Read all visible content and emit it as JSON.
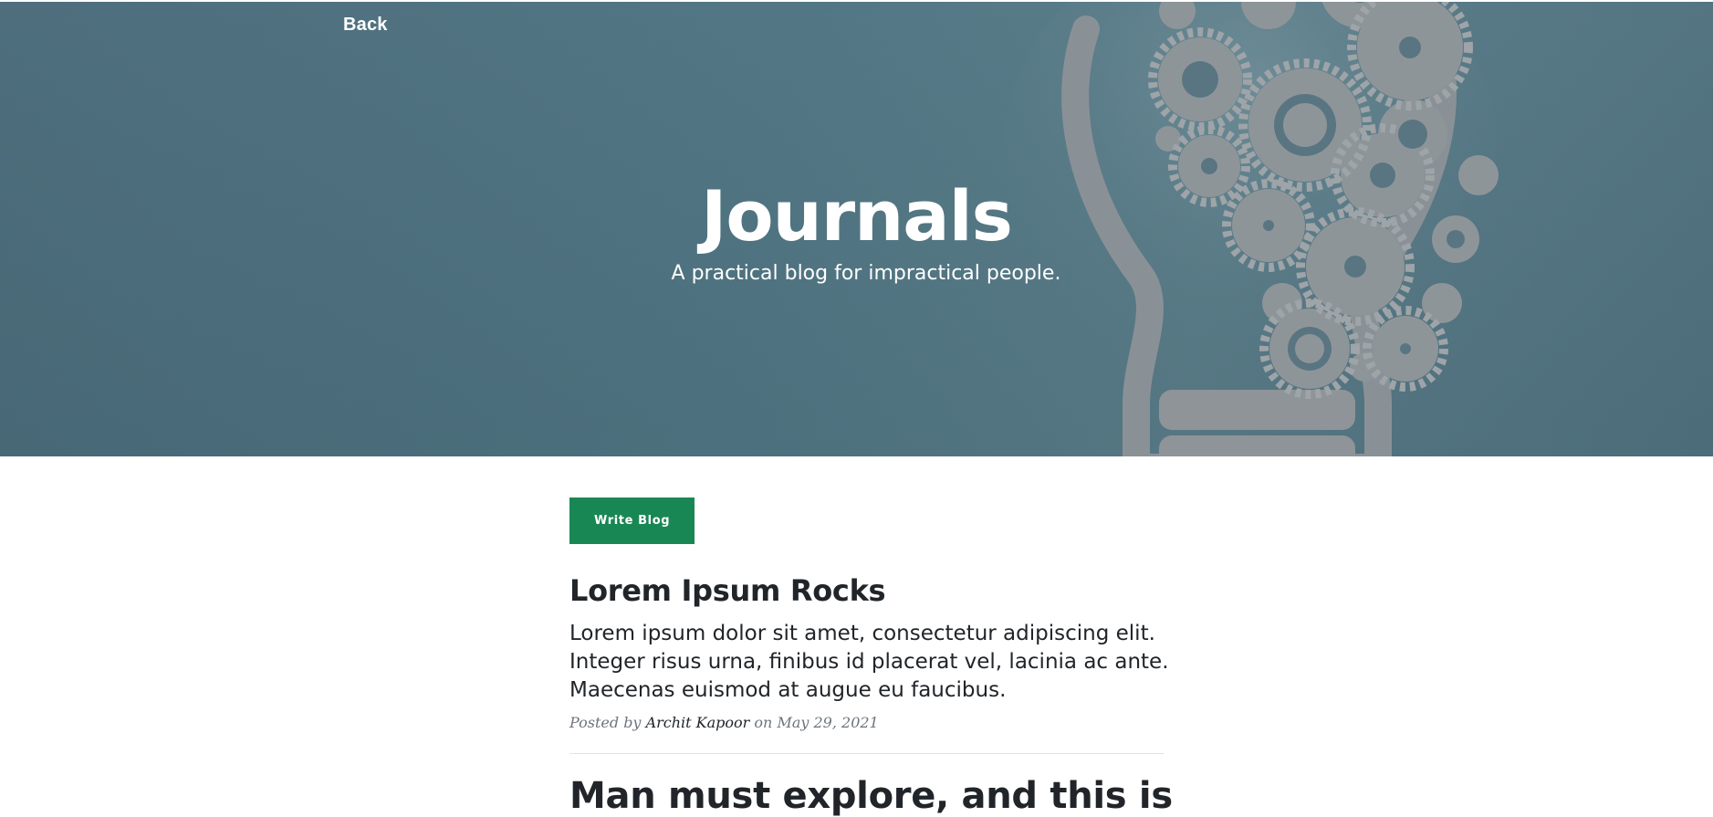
{
  "nav": {
    "back_label": "Back"
  },
  "hero": {
    "title": "Journals",
    "subtitle": "A practical blog for impractical people."
  },
  "actions": {
    "write_label": "Write Blog"
  },
  "posts": [
    {
      "title": "Lorem Ipsum Rocks",
      "excerpt": "Lorem ipsum dolor sit amet, consectetur adipiscing elit. Integer risus urna, finibus id placerat vel, lacinia ac ante. Maecenas euismod at augue eu faucibus.",
      "posted_by_prefix": "Posted by",
      "author": "Archit Kapoor",
      "date_prefix": "on",
      "date": "May 29, 2021"
    },
    {
      "title": "Man must explore, and this is"
    }
  ],
  "colors": {
    "hero_bg": "#4f7482",
    "button_bg": "#198754",
    "text_dark": "#212529",
    "text_muted": "#6c757d"
  },
  "icons": {
    "hero_image": "lightbulb-gears-illustration"
  }
}
